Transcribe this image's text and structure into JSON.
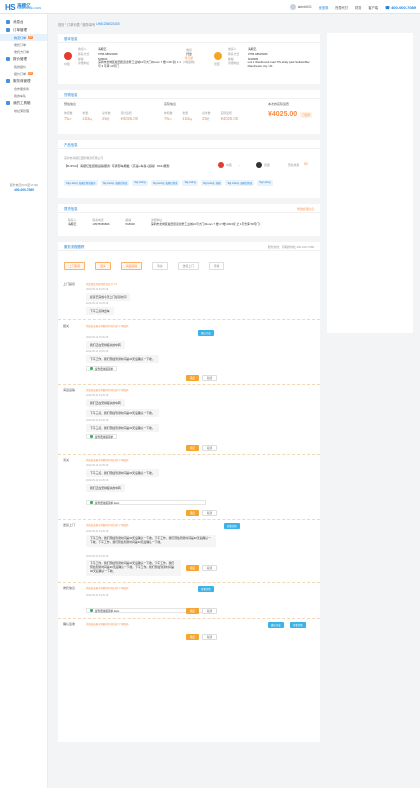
{
  "brand": {
    "name_cn": "海顺亿",
    "name_en": "HANDSHAKE LOGIS"
  },
  "topbar": {
    "user": "admin001",
    "items": [
      "优惠券",
      "所属代付",
      "财务",
      "客户端"
    ],
    "phone": "400-000-7089"
  },
  "sidebar": {
    "groups": [
      {
        "label": "消息台",
        "subs": []
      },
      {
        "label": "订单管理",
        "subs": [
          {
            "label": "物流订单",
            "badge": "12",
            "active": true
          },
          {
            "label": "委托订单",
            "badge": ""
          },
          {
            "label": "委托方订单",
            "badge": ""
          }
        ]
      },
      {
        "label": "报价管理",
        "subs": [
          {
            "label": "我的报价",
            "badge": ""
          },
          {
            "label": "报价订单",
            "badge": "12"
          }
        ]
      },
      {
        "label": "服务商管理",
        "subs": [
          {
            "label": "合作服务商",
            "badge": ""
          },
          {
            "label": "我的车队",
            "badge": ""
          }
        ]
      },
      {
        "label": "我的工具箱",
        "subs": [
          {
            "label": "地址薄管理",
            "badge": ""
          }
        ]
      }
    ],
    "contact_label": "服务电话(9:00至17:00)",
    "contact_phone": "400-000-7089"
  },
  "breadcrumb": {
    "root": "首页",
    "sep1": "/",
    "mid": "订单列表",
    "sep2": "/",
    "current_label": "服务单号",
    "current_no": "LH81238023100"
  },
  "basic": {
    "title": "基本信息",
    "left": {
      "flag_label": "中国",
      "name_label": "收货人",
      "name": "海顺亿",
      "phone_label": "联系方式",
      "phone": "0755-98523366",
      "mail_label": "邮编",
      "mail": "518000",
      "addr_label": "详细地址",
      "addr": "深圳市龙岗区坂田街道龙壁工业城12号大门(Room 7 楼 C18 室) 1 1 号 5 号库 10号门"
    },
    "ship": {
      "mode": "散货",
      "pkg": "托盘",
      "unit": "(3箱货物)",
      "status": "待订舱"
    },
    "right": {
      "flag_label": "德国",
      "name_label": "收货人",
      "name": "海顺亿",
      "phone_label": "联系方式",
      "phone": "0755-98523366",
      "mail_label": "邮编",
      "mail": "M40999",
      "addr_label": "详细地址",
      "addr": "unit 1 Westbound road TIS ahaly park Selfield Ber. Manchester city. UK"
    }
  },
  "cargo": {
    "title": "货物信息",
    "pre": {
      "h": "预估信息",
      "items": [
        {
          "l": "体积数",
          "n": "75",
          "u": "m³"
        },
        {
          "l": "重量",
          "n": "153",
          "u": "kg"
        },
        {
          "l": "总件数",
          "n": "25",
          "u": "托"
        },
        {
          "l": "预计运费",
          "n": "¥4025.00",
          "u": ""
        }
      ]
    },
    "act": {
      "h": "实际信息",
      "items": [
        {
          "l": "体积数",
          "n": "76",
          "u": "m³"
        },
        {
          "l": "重量",
          "n": "153",
          "u": "kg"
        },
        {
          "l": "总件数",
          "n": "25",
          "u": "托"
        },
        {
          "l": "实际运费",
          "n": "¥4025.00",
          "u": ""
        }
      ]
    },
    "final": {
      "h": "本次的实际运费",
      "n": "¥4025.00",
      "tag": "已结算"
    }
  },
  "goods": {
    "title": "产品信息",
    "company": "深圳市海顺亿国际物流有限公司",
    "name": "【B-IPCA】海顺亿集装箱运输服务: 可拆卸车厢板（高速+车载+运输）DDU服务",
    "from_label": "中国",
    "to_label": "德国",
    "weight_label": "预估重量",
    "weight": "50",
    "tags": [
      "Tag Listing: 海顺亿物流服务",
      "Tag Listing: 海顺亿物流",
      "Tag Listing",
      "Tag Listing: 海顺亿物流",
      "Tag Listing",
      "Tag Listing: 海顺",
      "Tag Listing: 海顺亿物流",
      "Tag Listing"
    ]
  },
  "pickup": {
    "title": "提货信息",
    "action": "修改提货信息",
    "cols": [
      {
        "l": "联系人",
        "v": "海顺亿"
      },
      {
        "l": "联系电话",
        "v": "13578459846"
      },
      {
        "l": "邮编",
        "v": "518000"
      },
      {
        "l": "详细地址",
        "v": "深圳市龙岗区坂田街道龙壁工业城12号大门(Room 7 楼 C7楼 2003室 之 1号仓库 58号门)"
      }
    ]
  },
  "track": {
    "title": "服务流程跟踪",
    "right_text": "服务热线：周期的地址 400-000-7089",
    "tabs": [
      "上门提货",
      "报关",
      "海运运输",
      "清关",
      "送货上门",
      "签收"
    ],
    "stages": [
      "上门提货",
      "报关",
      "海运运输",
      "清关",
      "送货上门",
      "委托信息",
      "确认签收"
    ],
    "msgs": {
      "m1": "系统消息您收到的消息了1了1",
      "m2": "提货已完成今天上门提货时间",
      "m3": "下午三点钟出车",
      "m4": "系统发送报关单据时的中转站1了1路线A",
      "m5": "我们正在安排报关的中转",
      "m6": "下午工作，我们预估到港时间是30天后确认一下收。",
      "m7": "我们正在安排报关的中转",
      "m8": "下午三点，我们预估到港时间是30天后确认一下收。",
      "m9": "我们正在安排报关的中转",
      "m10": "下午工作，我们预估到港时间是30天后确认一下收。下午工作，我们预估到港时间是30天后确认一下收。下午工作，我们预估到港时间是30天后确认一下收。",
      "m11": "下午工作，我们预估到港时间是30天后确认一下收。下午工作，我们预估到港时间是30天后确认一下收。下午工作。我们预估到港时间是30天后确认一下收。"
    },
    "file": "提件费用报销单",
    "file2": "提件费用报销单.docx",
    "btn_ok": "确定",
    "btn_cancel": "取消",
    "btn_confirm": "确认完成",
    "btn_view": "查看详情",
    "time": "2019-05-12 10:25:18"
  }
}
